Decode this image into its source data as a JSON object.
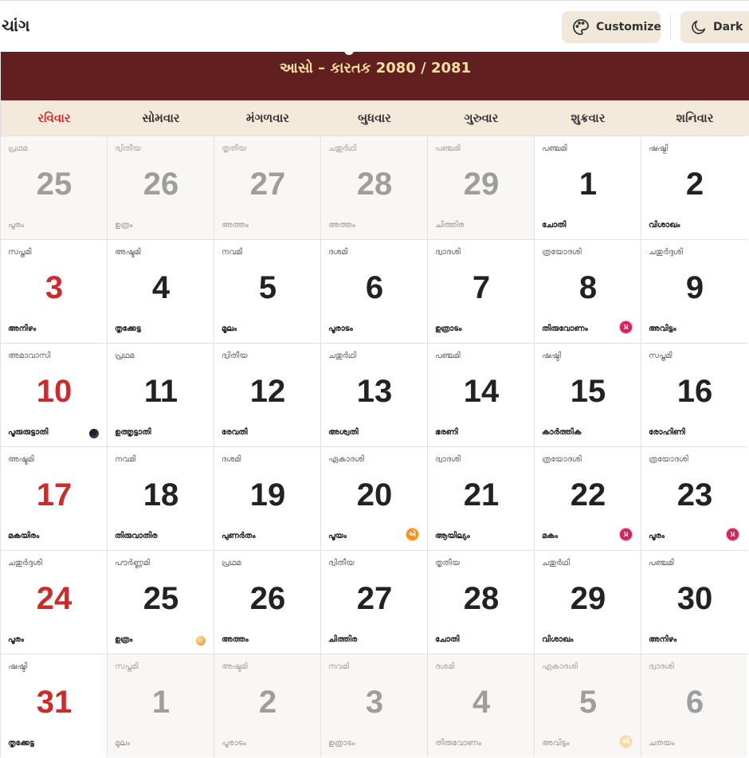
{
  "header": {
    "title": "ચાંગ",
    "customize_label": "Customize",
    "dark_label": "Dark"
  },
  "month": {
    "title": "આસો – કારતક 2080 / 2081"
  },
  "weekdays": [
    "રવિવાર",
    "સોમવાર",
    "મંગળવાર",
    "બુધવાર",
    "ગુરુવાર",
    "શુક્રવાર",
    "શનિવાર"
  ],
  "badge_labels": {
    "pradosh": "પ્ર",
    "ekadashi": "એ"
  },
  "colors": {
    "sunday_red": "#cc2b2b",
    "header_maroon": "#621f1f",
    "pradosh": "#d2245f",
    "ekadashi": "#f2921c"
  },
  "days": [
    {
      "d": "25",
      "t": "പ്രഥമ",
      "s": "പൂരം",
      "m": true
    },
    {
      "d": "26",
      "t": "ദ്വിതീയ",
      "s": "ഉത്രം",
      "m": true
    },
    {
      "d": "27",
      "t": "തൃതീയ",
      "s": "അത്തം",
      "m": true
    },
    {
      "d": "28",
      "t": "ചതുർഥി",
      "s": "അത്തം",
      "m": true
    },
    {
      "d": "29",
      "t": "പഞ്ചമി",
      "s": "ചിത്തിര",
      "m": true
    },
    {
      "d": "1",
      "t": "പഞ്ചമി",
      "s": "ചോതി"
    },
    {
      "d": "2",
      "t": "ഷഷ്ഠി",
      "s": "വിശാഖം"
    },
    {
      "d": "3",
      "t": "സപ്തമി",
      "s": "അനിഴം"
    },
    {
      "d": "4",
      "t": "അഷ്ടമി",
      "s": "തൃക്കേട്ട"
    },
    {
      "d": "5",
      "t": "നവമി",
      "s": "മൂലം"
    },
    {
      "d": "6",
      "t": "ദശമി",
      "s": "പൂരാടം"
    },
    {
      "d": "7",
      "t": "ദ്വാദശി",
      "s": "ഉത്രാടം"
    },
    {
      "d": "8",
      "t": "ത്രയോദശി",
      "s": "തിരുവോണം",
      "b": "pradosh"
    },
    {
      "d": "9",
      "t": "ചതുർദ്ദശി",
      "s": "അവിട്ടം"
    },
    {
      "d": "10",
      "t": "അമാവാസി",
      "s": "പൂരുരുട്ടാതി",
      "moon": "new"
    },
    {
      "d": "11",
      "t": "പ്രഥമ",
      "s": "ഉത്തൃട്ടാതി"
    },
    {
      "d": "12",
      "t": "ദ്വിതീയ",
      "s": "രേവതി"
    },
    {
      "d": "13",
      "t": "ചതുർഥി",
      "s": "അശ്വതി"
    },
    {
      "d": "14",
      "t": "പഞ്ചമി",
      "s": "ഭരണി"
    },
    {
      "d": "15",
      "t": "ഷഷ്ഠി",
      "s": "കാർത്തിക"
    },
    {
      "d": "16",
      "t": "സപ്തമി",
      "s": "രോഹിണി"
    },
    {
      "d": "17",
      "t": "അഷ്ടമി",
      "s": "മകയിരം"
    },
    {
      "d": "18",
      "t": "നവമി",
      "s": "തിരുവാതിര"
    },
    {
      "d": "19",
      "t": "ദശമി",
      "s": "പുണർതം"
    },
    {
      "d": "20",
      "t": "ഏകാദശി",
      "s": "പൂയം",
      "b": "ekadashi"
    },
    {
      "d": "21",
      "t": "ദ്വാദശി",
      "s": "ആയില്യം"
    },
    {
      "d": "22",
      "t": "ത്രയോദശി",
      "s": "മകം",
      "b": "pradosh"
    },
    {
      "d": "23",
      "t": "ത്രയോദശി",
      "s": "പൂരം",
      "b": "pradosh"
    },
    {
      "d": "24",
      "t": "ചതുർദ്ദശി",
      "s": "പൂരം"
    },
    {
      "d": "25",
      "t": "പൗർണ്ണമി",
      "s": "ഉത്രം",
      "moon": "full"
    },
    {
      "d": "26",
      "t": "പ്രഥമ",
      "s": "അത്തം"
    },
    {
      "d": "27",
      "t": "ദ്വിതീയ",
      "s": "ചിത്തിര"
    },
    {
      "d": "28",
      "t": "തൃതീയ",
      "s": "ചോതി"
    },
    {
      "d": "29",
      "t": "ചതുർഥി",
      "s": "വിശാഖം"
    },
    {
      "d": "30",
      "t": "പഞ്ചമി",
      "s": "അനിഴം"
    },
    {
      "d": "31",
      "t": "ഷഷ്ഠി",
      "s": "തൃക്കേട്ട"
    },
    {
      "d": "1",
      "t": "സപ്തമി",
      "s": "മൂലം",
      "m": true
    },
    {
      "d": "2",
      "t": "അഷ്ടമി",
      "s": "പൂരാടം",
      "m": true
    },
    {
      "d": "3",
      "t": "നവമി",
      "s": "ഉത്രാടം",
      "m": true
    },
    {
      "d": "4",
      "t": "ദശമി",
      "s": "തിരുവോണം",
      "m": true
    },
    {
      "d": "5",
      "t": "ഏകാദശി",
      "s": "അവിട്ടം",
      "m": true,
      "b": "ekadashi"
    },
    {
      "d": "6",
      "t": "ദ്വാദശി",
      "s": "ചതയം",
      "m": true
    }
  ]
}
